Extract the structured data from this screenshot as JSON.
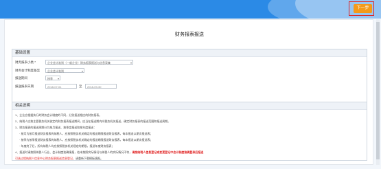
{
  "toolbar": {
    "next_label": "下一步"
  },
  "page_title": "财务报表报送",
  "basic": {
    "header": "基础设置",
    "rows": [
      {
        "label": "财务报表小类 *",
        "value": "企业会计准则（一般企业）财务报表报送与信息采集"
      },
      {
        "label": "财务会计制度备案",
        "value": "企业会计准则"
      },
      {
        "label": "报送期间",
        "value": "按季"
      },
      {
        "label": "报送报表日期",
        "start": "2018-07-01",
        "separator": "至",
        "end": "2018-09-30"
      }
    ]
  },
  "notes": {
    "header": "相关说明",
    "lines": [
      {
        "text": "1、企业应根据执行的财务会计制度的不同，分别报送相应的财务报表。",
        "indent": false
      },
      {
        "text": "2、纳税人应按主管税务机关核定的财务报表报送期间，应当在报送期内向税务机关报送，确定财务报表的报送范围和报送周期。",
        "indent": false
      },
      {
        "text": "3、财务报表的报送周期分为按月报送、按季度报送和按年度报送：",
        "indent": false
      },
      {
        "text": "· 按月为按月报送财务报表的纳税人，应按照税务机关确定的报送期限报送财务报表，每本报送以期次报送表；",
        "indent": true
      },
      {
        "text": "· 按季为按季报送财务报表的纳税人，应按照税务机关确定的报送期限报送财务报表，每本报送以期次报送表；",
        "indent": true
      },
      {
        "text": "· 年度终了后，所有纳税人均应按照税务机关规定的期限，报送年度财务报表；",
        "indent": true
      }
    ],
    "line7_prefix": "4、报送时请按照纳税人行业、会计制度准确填报，若未按照实际情况与纳税人的实际情况不符，",
    "line7_red": "请按纳税人信息登记或变更登记中会计制度准确登录后报送",
    "line8_red": "可选过程纳税人信息中心财务报表报送信息登记，",
    "line8_plain": "请重新下载模板填报。"
  }
}
